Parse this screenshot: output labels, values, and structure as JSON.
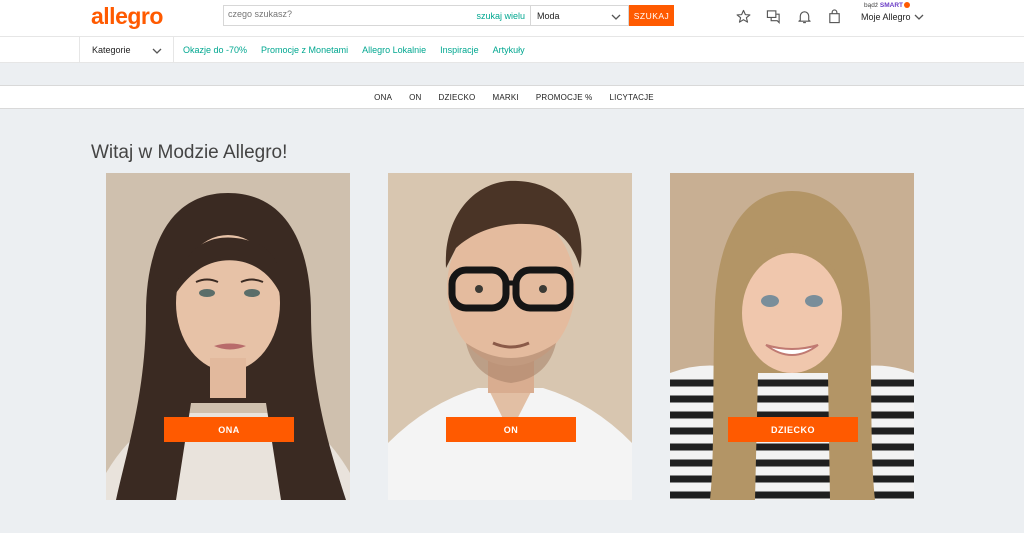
{
  "header": {
    "logo": "allegro",
    "search": {
      "placeholder": "czego szukasz?",
      "many_link": "szukaj wielu"
    },
    "category_select": {
      "value": "Moda"
    },
    "search_button": "SZUKAJ",
    "smart": {
      "prefix": "bądź",
      "brand": "SMART"
    },
    "account_label": "Moje Allegro"
  },
  "navbar": {
    "categories_label": "Kategorie",
    "links": [
      "Okazje do -70%",
      "Promocje z Monetami",
      "Allegro Lokalnie",
      "Inspiracje",
      "Artykuły"
    ]
  },
  "category_bar": {
    "links": [
      "ONA",
      "ON",
      "DZIECKO",
      "MARKI",
      "PROMOCJE %",
      "LICYTACJE"
    ]
  },
  "main": {
    "title": "Witaj w Modzie Allegro!",
    "cards": [
      {
        "label": "ONA",
        "image": "woman-portrait"
      },
      {
        "label": "ON",
        "image": "man-portrait"
      },
      {
        "label": "DZIECKO",
        "image": "child-portrait"
      }
    ]
  },
  "colors": {
    "accent": "#ff5a00",
    "link": "#00a790",
    "background": "#eceff2"
  }
}
